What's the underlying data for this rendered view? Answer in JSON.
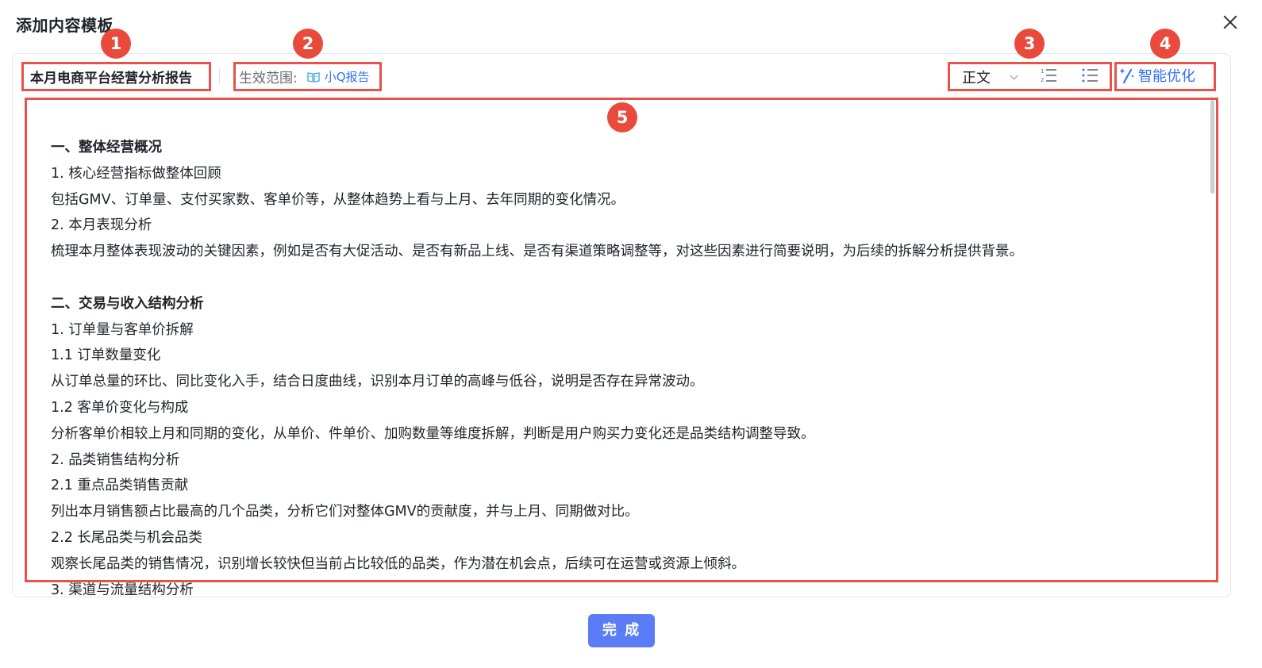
{
  "dialog": {
    "title": "添加内容模板",
    "close_icon": "close-icon"
  },
  "toolbar": {
    "template_title": "本月电商平台经营分析报告",
    "scope_label": "生效范围:",
    "scope_value": "小Q报告",
    "scope_icon": "book-icon",
    "text_style": "正文",
    "ordered_list_icon": "ordered-list-icon",
    "unordered_list_icon": "unordered-list-icon",
    "ai_optimize_label": "智能优化",
    "ai_optimize_icon": "magic-wand-icon"
  },
  "annotations": [
    "1",
    "2",
    "3",
    "4",
    "5"
  ],
  "content": {
    "paragraphs": [
      {
        "text": "一、整体经营概况",
        "bold": true
      },
      {
        "text": "1. 核心经营指标做整体回顾",
        "bold": false
      },
      {
        "text": "包括GMV、订单量、支付买家数、客单价等，从整体趋势上看与上月、去年同期的变化情况。",
        "bold": false
      },
      {
        "text": "2. 本月表现分析",
        "bold": false
      },
      {
        "text": "梳理本月整体表现波动的关键因素，例如是否有大促活动、是否有新品上线、是否有渠道策略调整等，对这些因素进行简要说明，为后续的拆解分析提供背景。",
        "bold": false
      },
      {
        "text": "",
        "bold": false
      },
      {
        "text": "二、交易与收入结构分析",
        "bold": true
      },
      {
        "text": "1. 订单量与客单价拆解",
        "bold": false
      },
      {
        "text": "1.1 订单数量变化",
        "bold": false
      },
      {
        "text": "从订单总量的环比、同比变化入手，结合日度曲线，识别本月订单的高峰与低谷，说明是否存在异常波动。",
        "bold": false
      },
      {
        "text": "1.2 客单价变化与构成",
        "bold": false
      },
      {
        "text": "分析客单价相较上月和同期的变化，从单价、件单价、加购数量等维度拆解，判断是用户购买力变化还是品类结构调整导致。",
        "bold": false
      },
      {
        "text": "2. 品类销售结构分析",
        "bold": false
      },
      {
        "text": "2.1 重点品类销售贡献",
        "bold": false
      },
      {
        "text": "列出本月销售额占比最高的几个品类，分析它们对整体GMV的贡献度，并与上月、同期做对比。",
        "bold": false
      },
      {
        "text": "2.2 长尾品类与机会品类",
        "bold": false
      },
      {
        "text": "观察长尾品类的销售情况，识别增长较快但当前占比较低的品类，作为潜在机会点，后续可在运营或资源上倾斜。",
        "bold": false
      },
      {
        "text": "3. 渠道与流量结构分析",
        "bold": false
      }
    ]
  },
  "footer": {
    "done_label": "完 成"
  },
  "colors": {
    "accent": "#3370ff",
    "primary_button": "#5b7cf7",
    "annotation": "#ea4a3c"
  }
}
